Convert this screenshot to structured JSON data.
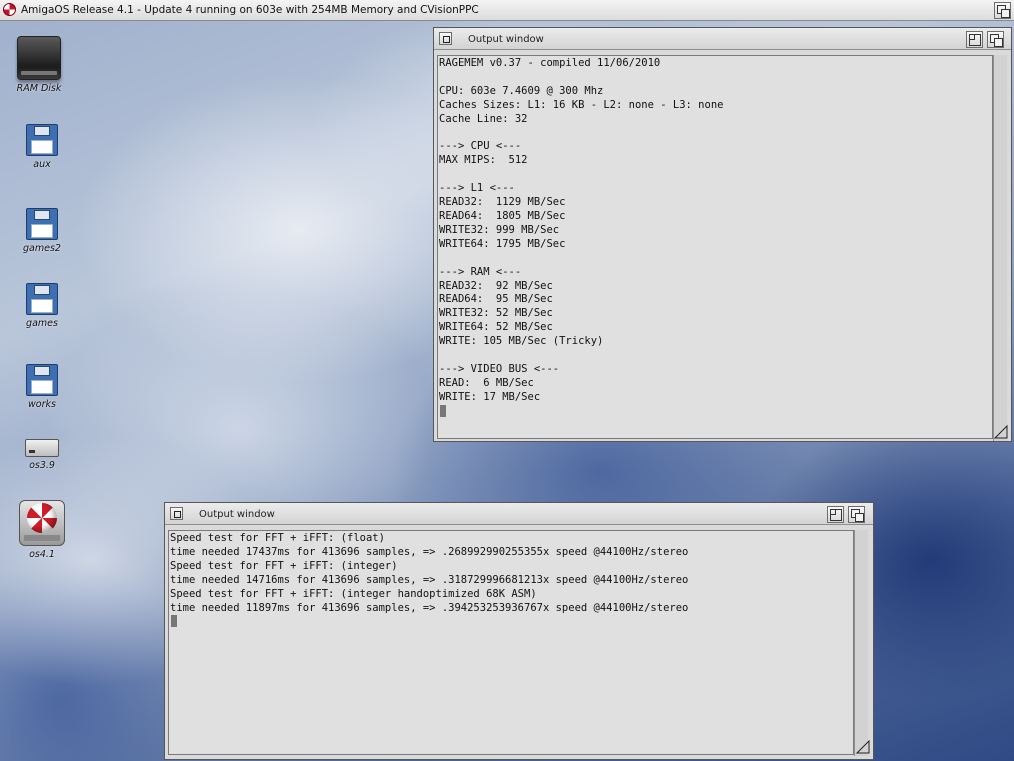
{
  "screen": {
    "title": "AmigaOS Release 4.1 - Update 4 running on 603e with 254MB Memory and CVisionPPC"
  },
  "desktop_icons": [
    {
      "label": "RAM Disk",
      "icon": "ram-disk-icon"
    },
    {
      "label": "aux",
      "icon": "floppy-icon"
    },
    {
      "label": "games2",
      "icon": "floppy-icon"
    },
    {
      "label": "games",
      "icon": "floppy-icon"
    },
    {
      "label": "works",
      "icon": "floppy-icon"
    },
    {
      "label": "os3.9",
      "icon": "harddisk-icon"
    },
    {
      "label": "os4.1",
      "icon": "boing-ball-drive-icon"
    }
  ],
  "window_top": {
    "title": "Output window",
    "text": "RAGEMEM v0.37 - compiled 11/06/2010\n\nCPU: 603e 7.4609 @ 300 Mhz\nCaches Sizes: L1: 16 KB - L2: none - L3: none\nCache Line: 32\n\n---> CPU <---\nMAX MIPS:  512\n\n---> L1 <---\nREAD32:  1129 MB/Sec\nREAD64:  1805 MB/Sec\nWRITE32: 999 MB/Sec\nWRITE64: 1795 MB/Sec\n\n---> RAM <---\nREAD32:  92 MB/Sec\nREAD64:  95 MB/Sec\nWRITE32: 52 MB/Sec\nWRITE64: 52 MB/Sec\nWRITE: 105 MB/Sec (Tricky)\n\n---> VIDEO BUS <---\nREAD:  6 MB/Sec\nWRITE: 17 MB/Sec\n"
  },
  "window_bottom": {
    "title": "Output window",
    "text": "Speed test for FFT + iFFT: (float)\ntime needed 17437ms for 413696 samples, => .268992990255355x speed @44100Hz/stereo\nSpeed test for FFT + iFFT: (integer)\ntime needed 14716ms for 413696 samples, => .318729996681213x speed @44100Hz/stereo\nSpeed test for FFT + iFFT: (integer handoptimized 68K ASM)\ntime needed 11897ms for 413696 samples, => .394253253936767x speed @44100Hz/stereo\n"
  }
}
